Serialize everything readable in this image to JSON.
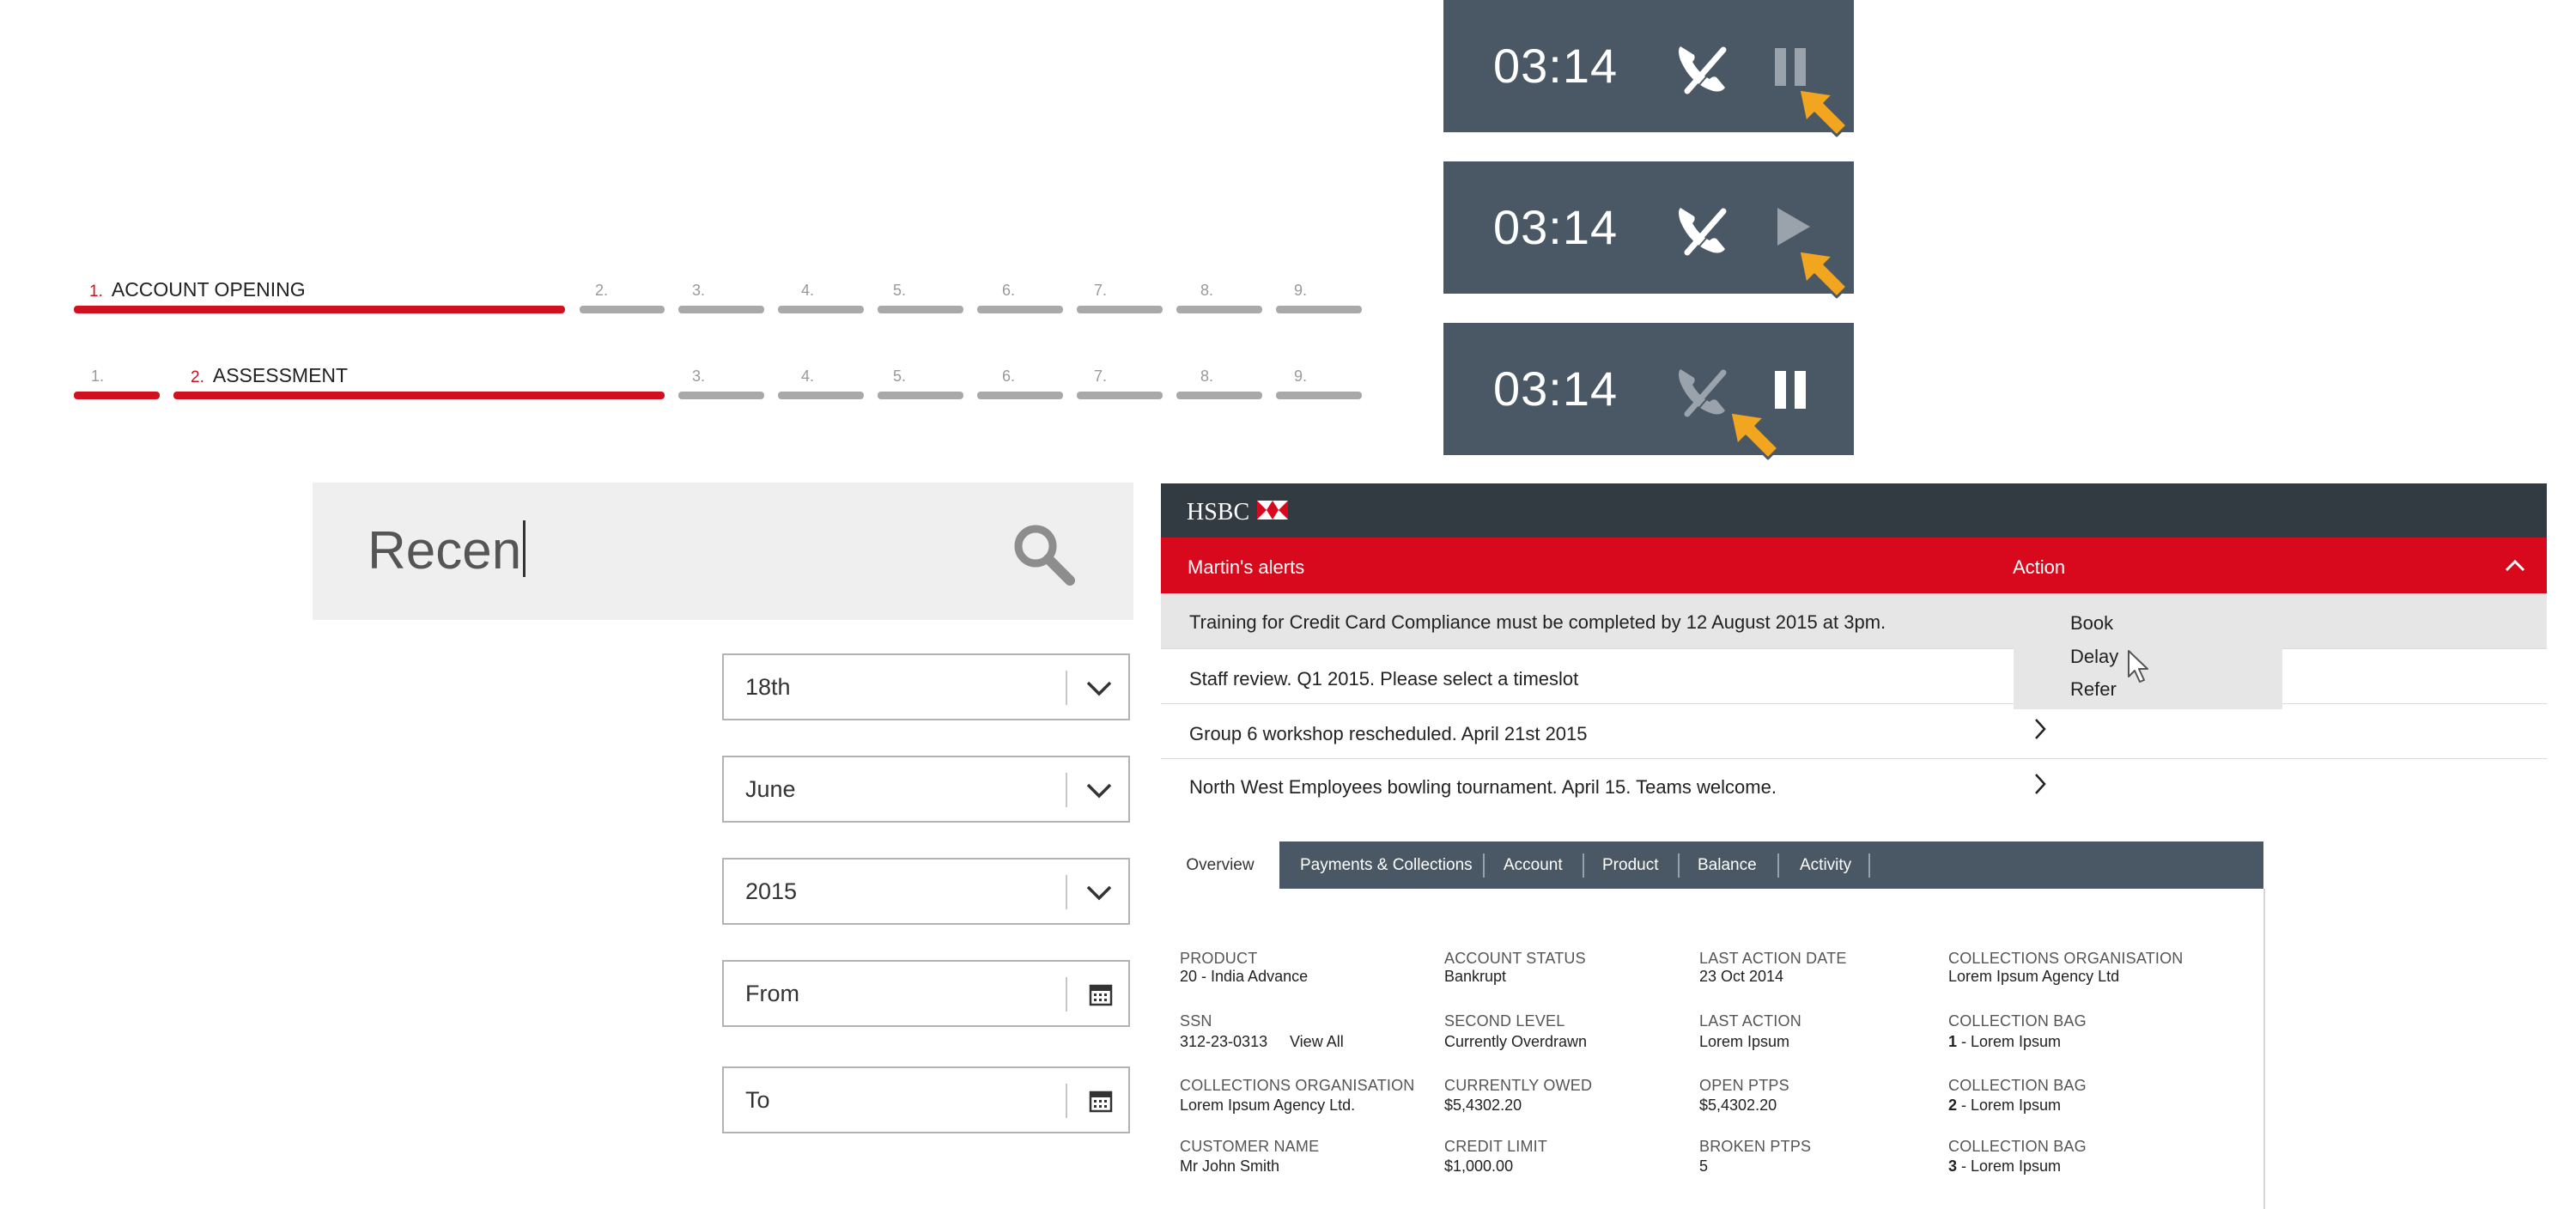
{
  "stepper_1": {
    "active_number": "1.",
    "active_label": "ACCOUNT OPENING",
    "steps": [
      "2.",
      "3.",
      "4.",
      "5.",
      "6.",
      "7.",
      "8.",
      "9."
    ]
  },
  "stepper_2": {
    "done_number": "1.",
    "active_number": "2.",
    "active_label": "ASSESSMENT",
    "steps": [
      "3.",
      "4.",
      "5.",
      "6.",
      "7.",
      "8.",
      "9."
    ]
  },
  "timers": [
    {
      "time": "03:14",
      "state": "pause-hover",
      "icons": [
        "phone-hangup-icon",
        "pause-icon",
        "cursor-arrow-icon"
      ]
    },
    {
      "time": "03:14",
      "state": "play-hover",
      "icons": [
        "phone-hangup-icon",
        "play-icon",
        "cursor-arrow-icon"
      ]
    },
    {
      "time": "03:14",
      "state": "hangup-hover",
      "icons": [
        "phone-hangup-icon",
        "pause-icon",
        "cursor-arrow-icon"
      ]
    }
  ],
  "search": {
    "value": "Recen",
    "icon": "search-icon"
  },
  "fields": [
    {
      "value": "18th",
      "icon": "chevron-down-icon"
    },
    {
      "value": "June",
      "icon": "chevron-down-icon"
    },
    {
      "value": "2015",
      "icon": "chevron-down-icon"
    },
    {
      "value": "From",
      "icon": "calendar-icon"
    },
    {
      "value": "To",
      "icon": "calendar-icon"
    }
  ],
  "alerts": {
    "brand": "HSBC",
    "header_title": "Martin's alerts",
    "header_action": "Action",
    "rows": [
      {
        "text": "Training for Credit Card Compliance must be completed by 12 August 2015 at 3pm."
      },
      {
        "text": "Staff review. Q1 2015. Please select a timeslot"
      },
      {
        "text": "Group 6 workshop rescheduled. April 21st 2015"
      },
      {
        "text": "North West Employees bowling tournament. April 15. Teams welcome."
      }
    ],
    "menu": [
      "Book",
      "Delay",
      "Refer"
    ]
  },
  "account": {
    "tabs": [
      "Overview",
      "Payments & Collections",
      "Account",
      "Product",
      "Balance",
      "Activity"
    ],
    "columns": [
      [
        {
          "label": "PRODUCT",
          "value": "20 - India Advance"
        },
        {
          "label": "SSN",
          "value": "312-23-0313",
          "link": "View All"
        },
        {
          "label": "COLLECTIONS ORGANISATION",
          "value": "Lorem Ipsum Agency Ltd."
        },
        {
          "label": "CUSTOMER NAME",
          "value": "Mr John Smith"
        }
      ],
      [
        {
          "label": "ACCOUNT STATUS",
          "value": "Bankrupt"
        },
        {
          "label": "SECOND LEVEL",
          "value": "Currently Overdrawn"
        },
        {
          "label": "CURRENTLY OWED",
          "value": "$5,4302.20"
        },
        {
          "label": "CREDIT LIMIT",
          "value": "$1,000.00"
        }
      ],
      [
        {
          "label": "LAST ACTION DATE",
          "value": "23 Oct 2014"
        },
        {
          "label": "LAST ACTION",
          "value": "Lorem Ipsum"
        },
        {
          "label": "OPEN PTPS",
          "value": "$5,4302.20"
        },
        {
          "label": "BROKEN PTPS",
          "value": "5"
        }
      ],
      [
        {
          "label": "COLLECTIONS ORGANISATION",
          "value": "Lorem Ipsum Agency Ltd"
        },
        {
          "label": "COLLECTION BAG",
          "value_bold": "1",
          "value": " - Lorem Ipsum"
        },
        {
          "label": "COLLECTION BAG",
          "value_bold": "2",
          "value": " - Lorem Ipsum"
        },
        {
          "label": "COLLECTION BAG",
          "value_bold": "3",
          "value": " - Lorem Ipsum"
        }
      ]
    ]
  },
  "colors": {
    "accent_red": "#d0101e",
    "slate": "#4a5865",
    "cursor_orange": "#f2a51f"
  }
}
